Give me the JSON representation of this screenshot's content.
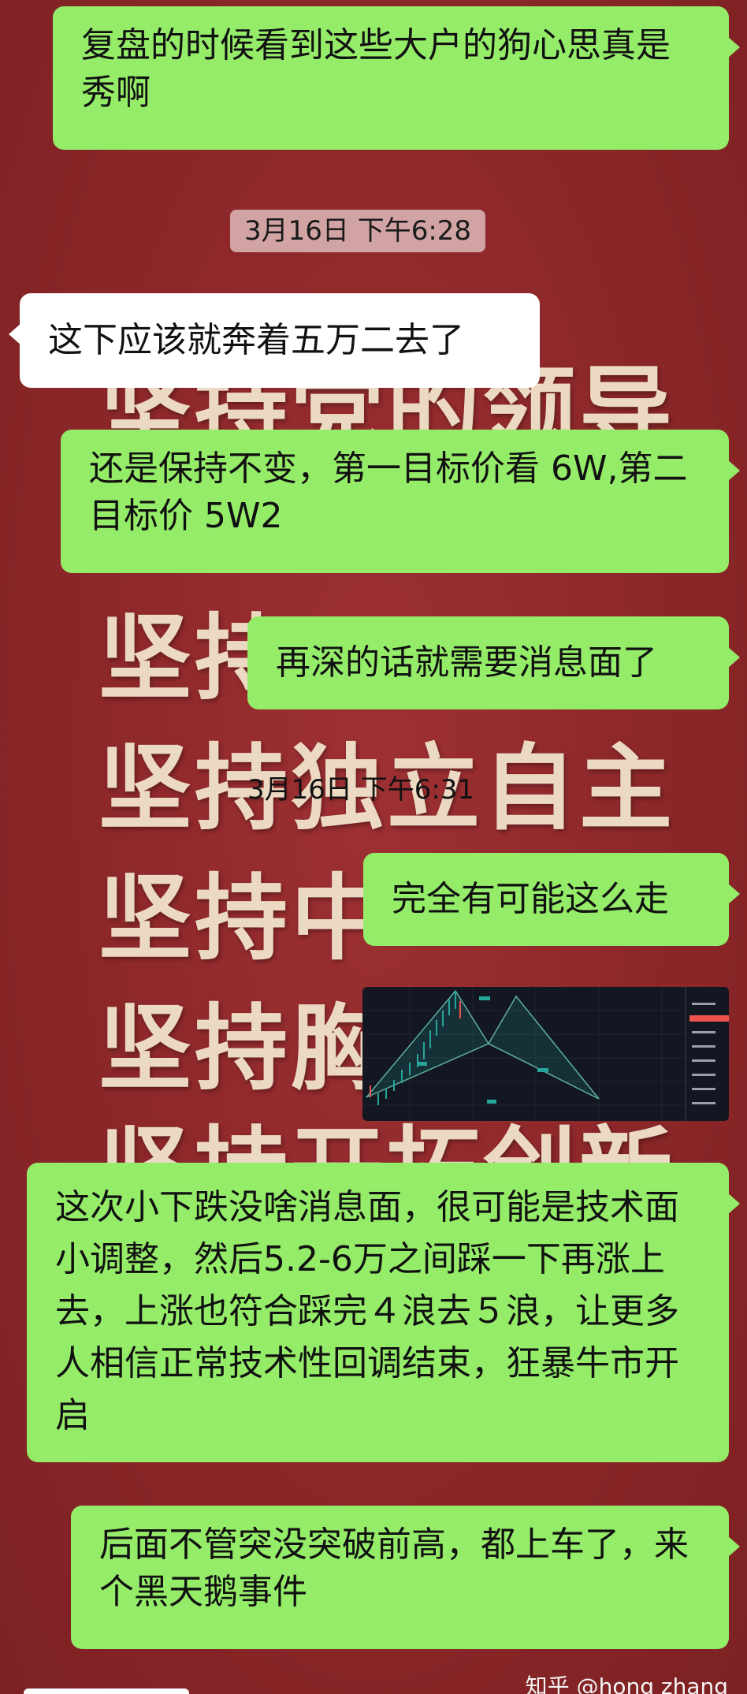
{
  "background_slogans": [
    "坚持党的领导",
    "坚持",
    "坚持独立自主",
    "坚持中",
    "坚持胸",
    "坚持开拓创新"
  ],
  "messages": [
    {
      "side": "right",
      "text": "复盘的时候看到这些大户的狗心思真是秀啊"
    },
    {
      "type": "timestamp",
      "text": "3月16日 下午6:28"
    },
    {
      "side": "left",
      "text": "这下应该就奔着五万二去了"
    },
    {
      "side": "right",
      "text": "还是保持不变，第一目标价看 6W,第二目标价 5W2"
    },
    {
      "side": "right",
      "text": "再深的话就需要消息面了"
    },
    {
      "type": "timestamp",
      "text": "3月16日 下午6:31"
    },
    {
      "side": "right",
      "text": "完全有可能这么走"
    },
    {
      "side": "right",
      "type": "image",
      "image_desc": "chart-screenshot"
    },
    {
      "side": "right",
      "text": "这次小下跌没啥消息面，很可能是技术面小调整，然后5.2-6万之间踩一下再涨上去，上涨也符合踩完４浪去５浪，让更多人相信正常技术性回调结束，狂暴牛市开启"
    },
    {
      "side": "right",
      "text": "后面不管突没突破前高，都上车了，来个黑天鹅事件"
    }
  ],
  "watermark": "知乎 @hong zhang",
  "colors": {
    "bubble_green": "#95ec69",
    "bubble_white": "#ffffff",
    "background_red": "#8f2a2c",
    "slogan_cream": "#f3e7cf"
  }
}
